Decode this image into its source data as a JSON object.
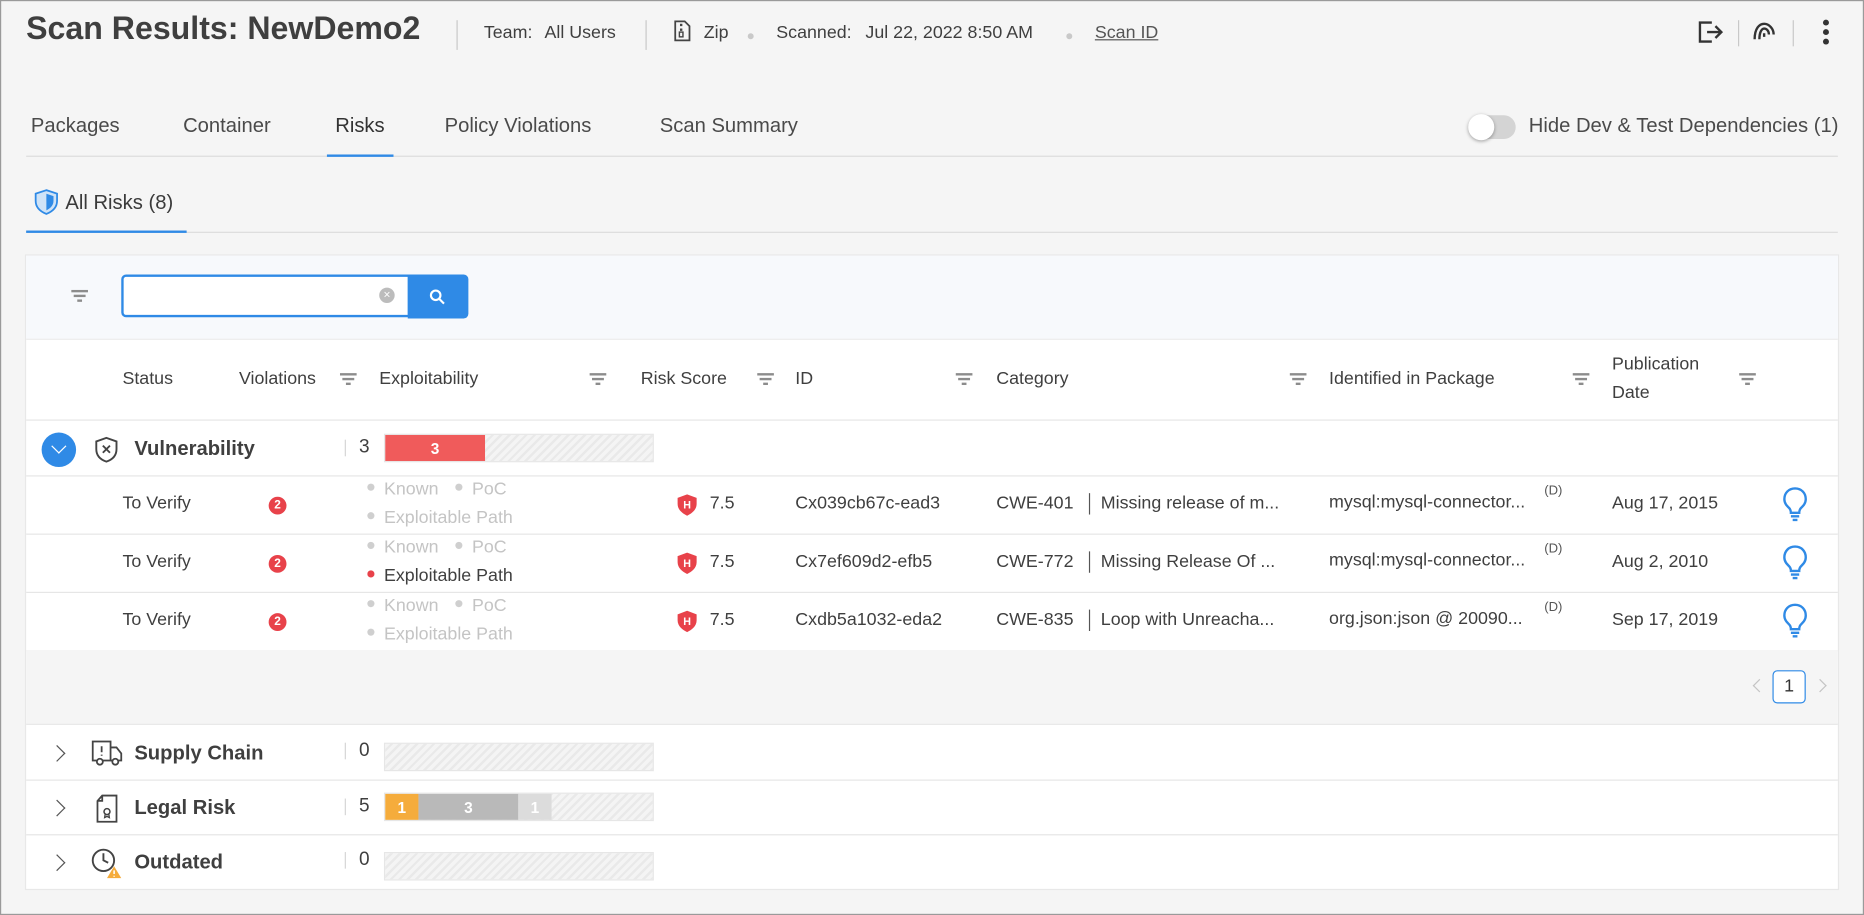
{
  "header": {
    "title": "Scan Results: NewDemo2",
    "team_label": "Team:",
    "team_value": "All Users",
    "source": "Zip",
    "scanned_label": "Scanned:",
    "scanned_value": "Jul 22, 2022 8:50 AM",
    "scan_id_link": "Scan ID"
  },
  "header_actions": [
    "export-icon",
    "fingerprint-icon",
    "more-options-icon"
  ],
  "tabs": [
    {
      "label": "Packages",
      "active": false
    },
    {
      "label": "Container",
      "active": false
    },
    {
      "label": "Risks",
      "active": true
    },
    {
      "label": "Policy Violations",
      "active": false
    },
    {
      "label": "Scan Summary",
      "active": false
    }
  ],
  "toggle": {
    "label": "Hide Dev & Test Dependencies (1)",
    "on": false
  },
  "subtab": {
    "label": "All Risks (8)"
  },
  "search": {
    "value": "",
    "placeholder": ""
  },
  "columns": {
    "status": "Status",
    "violations": "Violations",
    "exploitability": "Exploitability",
    "risk_score": "Risk Score",
    "id": "ID",
    "category": "Category",
    "package": "Identified in Package",
    "pub_line1": "Publication",
    "pub_line2": "Date"
  },
  "groups": [
    {
      "name": "Vulnerability",
      "count": "3",
      "expanded": true,
      "segments": [
        {
          "label": "3",
          "value": 3,
          "color": "#f05b5b"
        }
      ]
    },
    {
      "name": "Supply Chain",
      "count": "0",
      "expanded": false,
      "segments": []
    },
    {
      "name": "Legal Risk",
      "count": "5",
      "expanded": false,
      "segments": [
        {
          "label": "1",
          "value": 1,
          "color": "#f5ac3c"
        },
        {
          "label": "3",
          "value": 3,
          "color": "#b9b9b9"
        },
        {
          "label": "1",
          "value": 1,
          "color": "#dcdcdc"
        }
      ]
    },
    {
      "name": "Outdated",
      "count": "0",
      "expanded": false,
      "segments": []
    }
  ],
  "bar_scale_max": 8,
  "exploit_labels": {
    "known": "Known",
    "poc": "PoC",
    "path": "Exploitable Path"
  },
  "rows": [
    {
      "status": "To Verify",
      "violations": "2",
      "known": false,
      "poc": false,
      "path": false,
      "risk_level": "H",
      "score": "7.5",
      "id": "Cx039cb67c-ead3",
      "cwe": "CWE-401",
      "category": "Missing release of m...",
      "package": "mysql:mysql-connector...",
      "pkg_flag": "(D)",
      "date": "Aug 17, 2015"
    },
    {
      "status": "To Verify",
      "violations": "2",
      "known": false,
      "poc": false,
      "path": true,
      "risk_level": "H",
      "score": "7.5",
      "id": "Cx7ef609d2-efb5",
      "cwe": "CWE-772",
      "category": "Missing Release Of ...",
      "package": "mysql:mysql-connector...",
      "pkg_flag": "(D)",
      "date": "Aug 2, 2010"
    },
    {
      "status": "To Verify",
      "violations": "2",
      "known": false,
      "poc": false,
      "path": false,
      "risk_level": "H",
      "score": "7.5",
      "id": "Cxdb5a1032-eda2",
      "cwe": "CWE-835",
      "category": "Loop with Unreacha...",
      "package": "org.json:json @ 20090...",
      "pkg_flag": "(D)",
      "date": "Sep 17, 2019"
    }
  ],
  "pagination": {
    "current": "1"
  },
  "colors": {
    "accent": "#2f8ae6",
    "danger": "#e8424a",
    "active_dot": "#e8424a"
  }
}
